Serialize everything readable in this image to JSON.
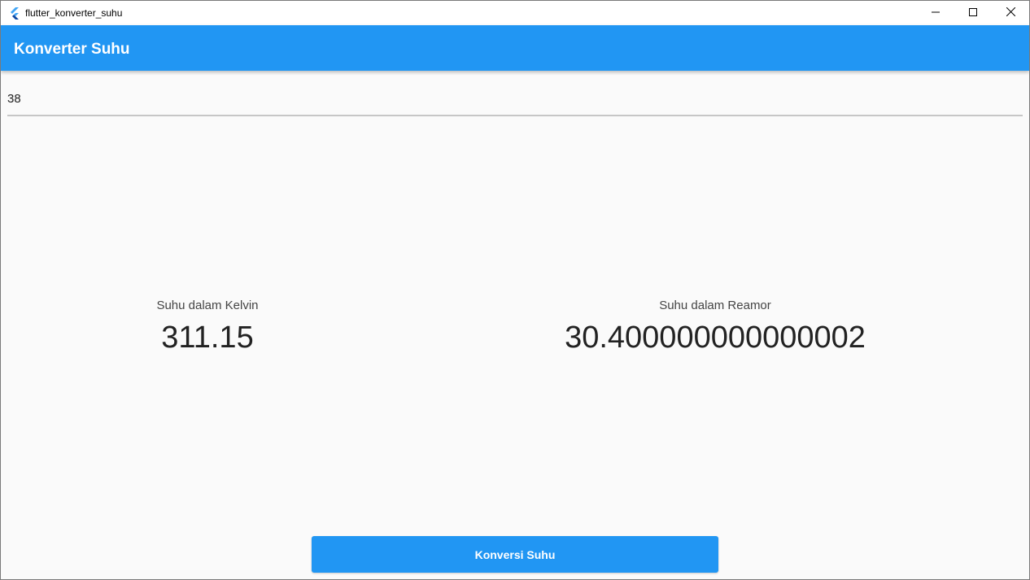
{
  "window": {
    "title": "flutter_konverter_suhu",
    "controls": {
      "minimize_icon": "minimize-icon",
      "maximize_icon": "maximize-icon",
      "close_icon": "close-icon"
    }
  },
  "appbar": {
    "title": "Konverter Suhu",
    "color": "#2196f3"
  },
  "input": {
    "value": "38"
  },
  "results": {
    "kelvin": {
      "label": "Suhu dalam Kelvin",
      "value": "311.15"
    },
    "reamor": {
      "label": "Suhu dalam Reamor",
      "value": "30.400000000000002"
    }
  },
  "button": {
    "label": "Konversi Suhu"
  }
}
